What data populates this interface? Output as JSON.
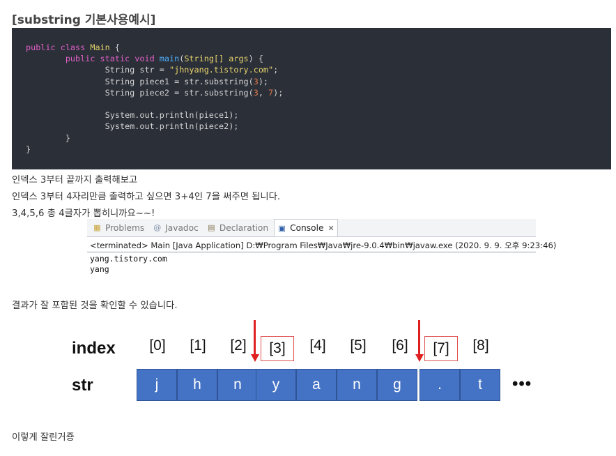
{
  "heading": "[substring 기본사용예시]",
  "code": {
    "l1_kw": "public class",
    "l1_name": "Main",
    "l1_brace": " {",
    "l2_kw": "public static void",
    "l2_fn": "main",
    "l2_open": "(",
    "l2_type": "String[]",
    "l2_arg": " args",
    "l2_close": ") {",
    "l3_a": "String str = ",
    "l3_str": "\"jhnyang.tistory.com\"",
    "l3_end": ";",
    "l4_a": "String piece1 = str.substring(",
    "l4_n": "3",
    "l4_end": ");",
    "l5_a": "String piece2 = str.substring(",
    "l5_n1": "3",
    "l5_sep": ", ",
    "l5_n2": "7",
    "l5_end": ");",
    "l7": "System.out.println(piece1);",
    "l8": "System.out.println(piece2);",
    "l9": "}",
    "l10": "}"
  },
  "paragraphs": {
    "p1": "인덱스 3부터 끝까지 출력해보고",
    "p2": "인덱스 3부터 4자리만큼 출력하고 싶으면 3+4인 7을 써주면 됩니다.",
    "p3": "3,4,5,6 총 4글자가 뽑히니까요~~!",
    "p4": "결과가 잘 포함된 것을 확인할 수 있습니다.",
    "p5": "이렇게 잘린거죵"
  },
  "console": {
    "tabs": [
      {
        "label": "Problems",
        "icon": "problems-icon"
      },
      {
        "label": "Javadoc",
        "icon": "at-icon"
      },
      {
        "label": "Declaration",
        "icon": "declaration-icon"
      },
      {
        "label": "Console",
        "icon": "console-icon"
      }
    ],
    "terminated": "<terminated> Main [Java Application] D:₩Program Files₩Java₩jre-9.0.4₩bin₩javaw.exe (2020. 9. 9. 오후 9:23:46)",
    "output1": "yang.tistory.com",
    "output2": "yang"
  },
  "diagram": {
    "index_label": "index",
    "str_label": "str",
    "indices": [
      "[0]",
      "[1]",
      "[2]",
      "[3]",
      "[4]",
      "[5]",
      "[6]",
      "[7]",
      "[8]"
    ],
    "chars": [
      "j",
      "h",
      "n",
      "y",
      "a",
      "n",
      "g",
      ".",
      "t"
    ],
    "ellipsis": "•••",
    "highlight_color": "#4472c4",
    "arrow_color": "#e02020"
  }
}
